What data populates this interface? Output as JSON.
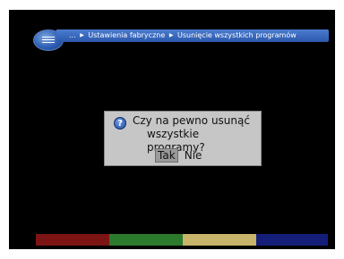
{
  "header": {
    "breadcrumb": [
      "...",
      "Ustawienia fabryczne",
      "Usunięcie wszystkich programów"
    ]
  },
  "dialog": {
    "line1": "Czy na pewno usunąć",
    "line2": "wszystkie programy?",
    "yes_label": "Tak",
    "no_label": "Nie",
    "selected": "Tak"
  },
  "icons": {
    "menu": "menu-icon",
    "question": "question-icon"
  },
  "color_keys": {
    "red": "#7c1414",
    "green": "#2c7a2c",
    "yellow": "#c8b46a",
    "blue": "#141e78"
  }
}
